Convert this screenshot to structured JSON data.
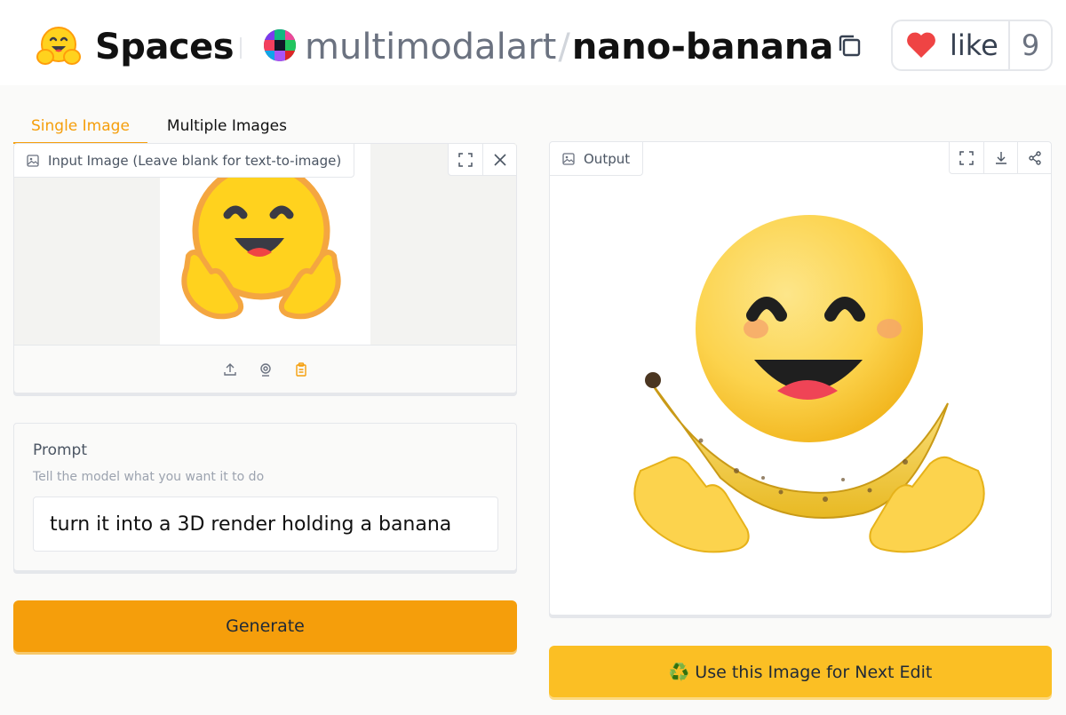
{
  "header": {
    "brand": "Spaces",
    "owner": "multimodalart",
    "separator": "/",
    "repo": "nano-banana",
    "like_label": "like",
    "like_count": "9"
  },
  "tabs": [
    {
      "label": "Single Image",
      "active": true
    },
    {
      "label": "Multiple Images",
      "active": false
    }
  ],
  "input_image": {
    "label": "Input Image (Leave blank for text-to-image)",
    "tools": [
      "fullscreen-icon",
      "close-icon"
    ],
    "sources": [
      "upload-icon",
      "webcam-icon",
      "clipboard-icon"
    ]
  },
  "prompt": {
    "label": "Prompt",
    "info": "Tell the model what you want it to do",
    "value": "turn it into a 3D render holding a banana"
  },
  "generate_label": "Generate",
  "output": {
    "label": "Output",
    "tools": [
      "fullscreen-icon",
      "download-icon",
      "share-icon"
    ]
  },
  "next_edit": {
    "icon": "♻️",
    "label": "Use this Image for Next Edit"
  },
  "colors": {
    "accent": "#f59e0b",
    "secondary_button": "#fbbf24",
    "like_heart": "#ef4444"
  }
}
